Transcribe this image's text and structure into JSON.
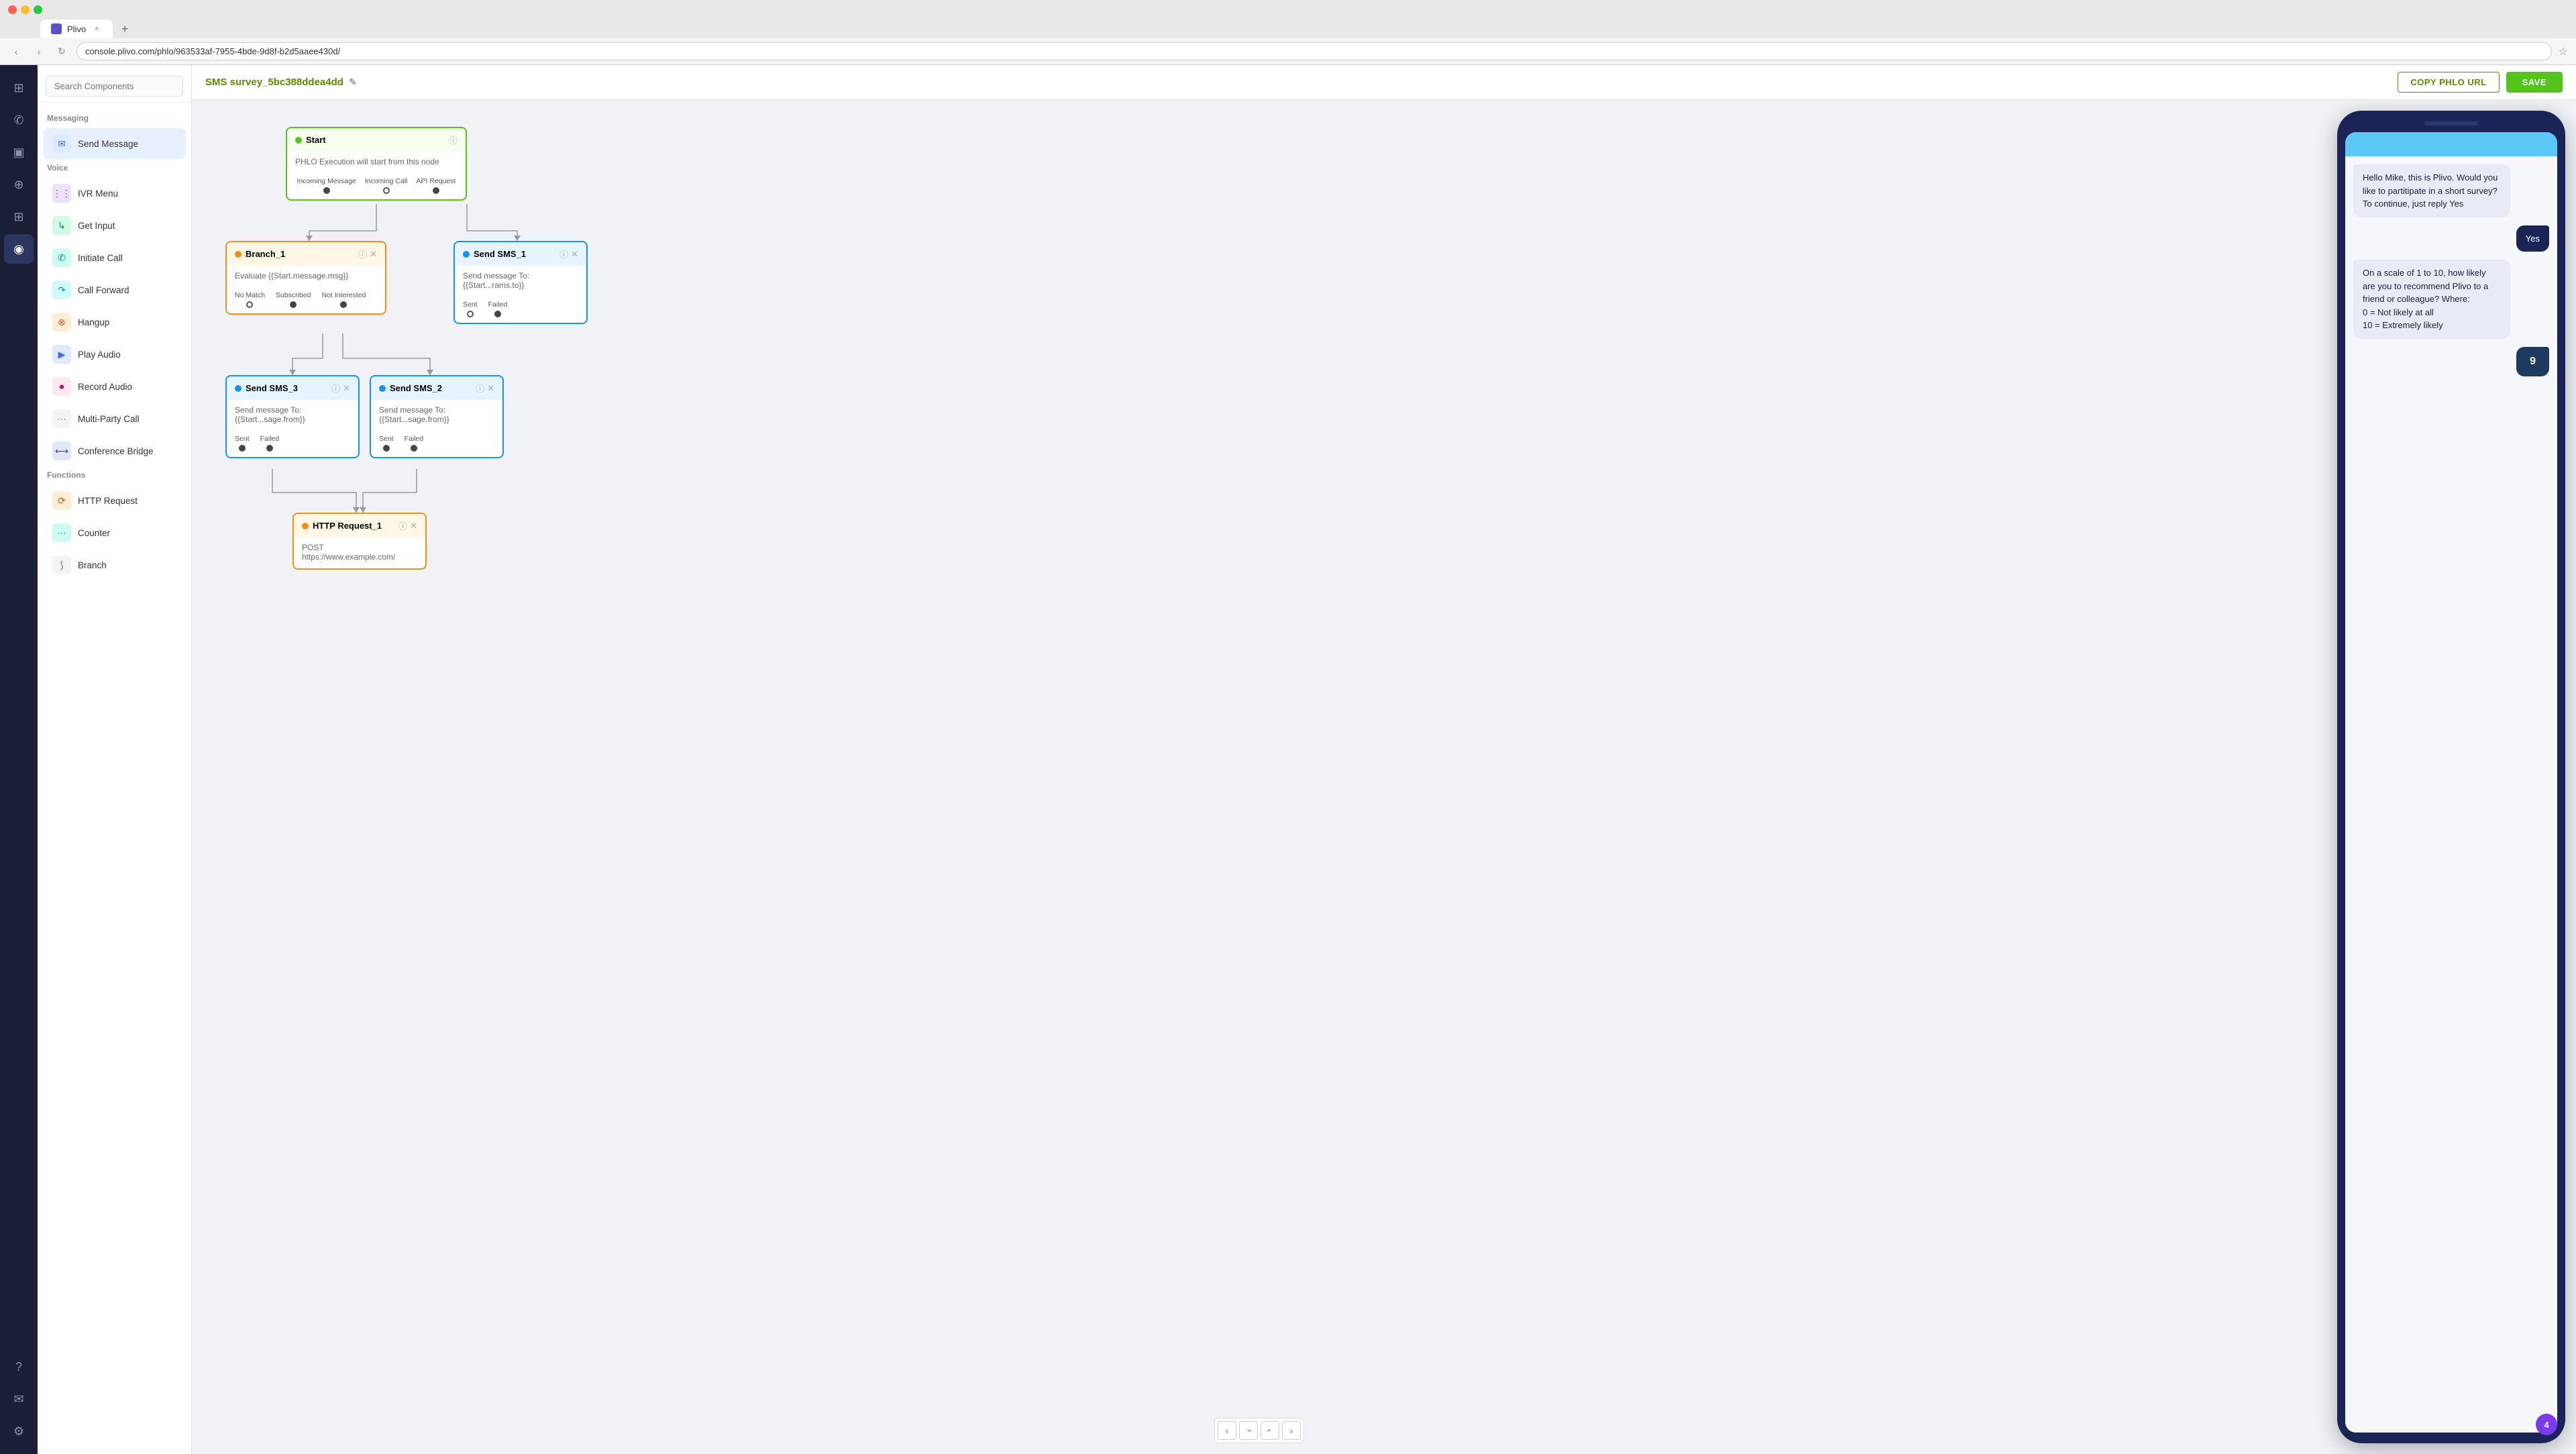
{
  "browser": {
    "traffic_lights": [
      "red",
      "yellow",
      "green"
    ],
    "tab_title": "Plivo",
    "tab_close": "×",
    "tab_new": "+",
    "nav_back": "‹",
    "nav_forward": "›",
    "nav_refresh": "↻",
    "address": "console.plivo.com/phlo/963533af-7955-4bde-9d8f-b2d5aaee430d/",
    "bookmark": "☆"
  },
  "top_bar": {
    "title": "SMS survey_5bc388ddea4dd",
    "edit_icon": "✎",
    "copy_btn": "COPY PHLO URL",
    "save_btn": "SAVE"
  },
  "sidebar_icons": [
    {
      "name": "home-icon",
      "icon": "⊞",
      "active": false
    },
    {
      "name": "phone-icon",
      "icon": "✆",
      "active": false
    },
    {
      "name": "messages-icon",
      "icon": "◫",
      "active": false
    },
    {
      "name": "search-icon",
      "icon": "⊕",
      "active": false
    },
    {
      "name": "apps-icon",
      "icon": "⊞",
      "active": false
    },
    {
      "name": "flow-icon",
      "icon": "⟴",
      "active": true
    },
    {
      "name": "help-icon",
      "icon": "?",
      "active": false
    },
    {
      "name": "mail-icon",
      "icon": "✉",
      "active": false
    },
    {
      "name": "settings-icon",
      "icon": "⚙",
      "active": false
    }
  ],
  "components_panel": {
    "search_placeholder": "Search Components",
    "sections": [
      {
        "label": "Messaging",
        "items": [
          {
            "id": "send-message",
            "label": "Send Message",
            "icon_type": "blue",
            "icon": "✉"
          }
        ]
      },
      {
        "label": "Voice",
        "items": [
          {
            "id": "ivr-menu",
            "label": "IVR Menu",
            "icon_type": "purple",
            "icon": "⋮⋮"
          },
          {
            "id": "get-input",
            "label": "Get Input",
            "icon_type": "green",
            "icon": "↳"
          },
          {
            "id": "initiate-call",
            "label": "Initiate Call",
            "icon_type": "teal",
            "icon": "✆"
          },
          {
            "id": "call-forward",
            "label": "Call Forward",
            "icon_type": "cyan",
            "icon": "↷"
          },
          {
            "id": "hangup",
            "label": "Hangup",
            "icon_type": "orange",
            "icon": "⊗"
          },
          {
            "id": "play-audio",
            "label": "Play Audio",
            "icon_type": "blue",
            "icon": "▶"
          },
          {
            "id": "record-audio",
            "label": "Record Audio",
            "icon_type": "pink",
            "icon": "⏺"
          },
          {
            "id": "multi-party-call",
            "label": "Multi-Party Call",
            "icon_type": "gray",
            "icon": "⋯"
          },
          {
            "id": "conference-bridge",
            "label": "Conference Bridge",
            "icon_type": "indigo",
            "icon": "⟷"
          }
        ]
      },
      {
        "label": "Functions",
        "items": [
          {
            "id": "http-request",
            "label": "HTTP Request",
            "icon_type": "orange",
            "icon": "⟳"
          },
          {
            "id": "counter",
            "label": "Counter",
            "icon_type": "teal",
            "icon": "⋯"
          },
          {
            "id": "branch",
            "label": "Branch",
            "icon_type": "gray",
            "icon": "⟆"
          }
        ]
      }
    ]
  },
  "flow": {
    "nodes": {
      "start": {
        "title": "Start",
        "description": "PHLO Execution will start from this node",
        "ports": [
          "Incoming Message",
          "Incoming Call",
          "API Request"
        ]
      },
      "branch_1": {
        "title": "Branch_1",
        "description": "Evaluate {{Start.message.msg}}",
        "ports": [
          "No Match",
          "Subscribed",
          "Not Interested"
        ]
      },
      "send_sms_1": {
        "title": "Send SMS_1",
        "description": "Send message To: {{Start...rams.to}}",
        "ports": [
          "Sent",
          "Failed"
        ]
      },
      "send_sms_3": {
        "title": "Send SMS_3",
        "description": "Send message To: {{Start...sage.from}}",
        "ports": [
          "Sent",
          "Failed"
        ]
      },
      "send_sms_2": {
        "title": "Send SMS_2",
        "description": "Send message To: {{Start...sage.from}}",
        "ports": [
          "Sent",
          "Failed"
        ]
      },
      "http_request_1": {
        "title": "HTTP Request_1",
        "description": "POST https://www.example.com/",
        "ports": []
      }
    }
  },
  "phone": {
    "messages": [
      {
        "type": "incoming",
        "text": "Hello Mike, this is Plivo. Would you like to partitipate in a short survey? To continue, just reply Yes"
      },
      {
        "type": "outgoing",
        "text": "Yes"
      },
      {
        "type": "incoming",
        "text": "On a scale of 1 to 10, how likely are you to recommend Plivo to a friend or colleague? Where:\n0 = Not likely at all\n10 = Extremely likely"
      },
      {
        "type": "outgoing-small",
        "text": "9"
      }
    ],
    "badge": "4"
  },
  "canvas_nav": {
    "left": "‹",
    "right": "›",
    "up": "›",
    "down": "›"
  }
}
